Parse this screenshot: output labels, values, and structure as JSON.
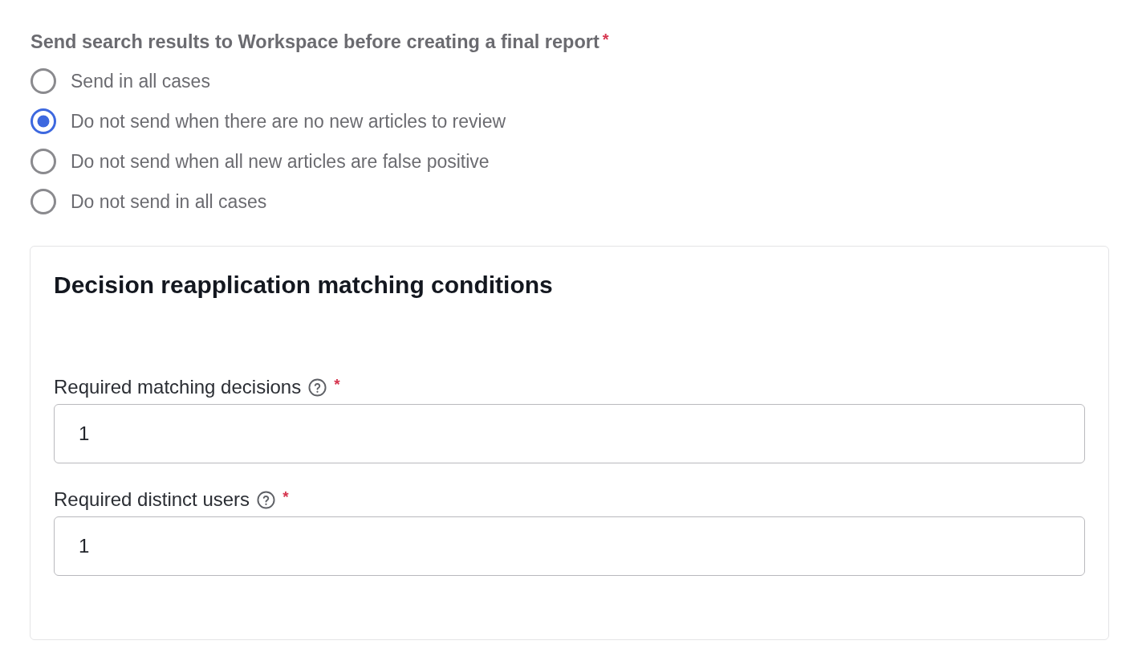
{
  "question": {
    "label": "Send search results to Workspace before creating a final report",
    "required_mark": "*"
  },
  "options": [
    {
      "label": "Send in all cases",
      "selected": false
    },
    {
      "label": "Do not send when there are no new articles to review",
      "selected": true
    },
    {
      "label": "Do not send when all new articles are false positive",
      "selected": false
    },
    {
      "label": "Do not send in all cases",
      "selected": false
    }
  ],
  "section": {
    "title": "Decision reapplication matching conditions",
    "fields": [
      {
        "label": "Required matching decisions",
        "required_mark": "*",
        "value": "1"
      },
      {
        "label": "Required distinct users",
        "required_mark": "*",
        "value": "1"
      }
    ]
  }
}
